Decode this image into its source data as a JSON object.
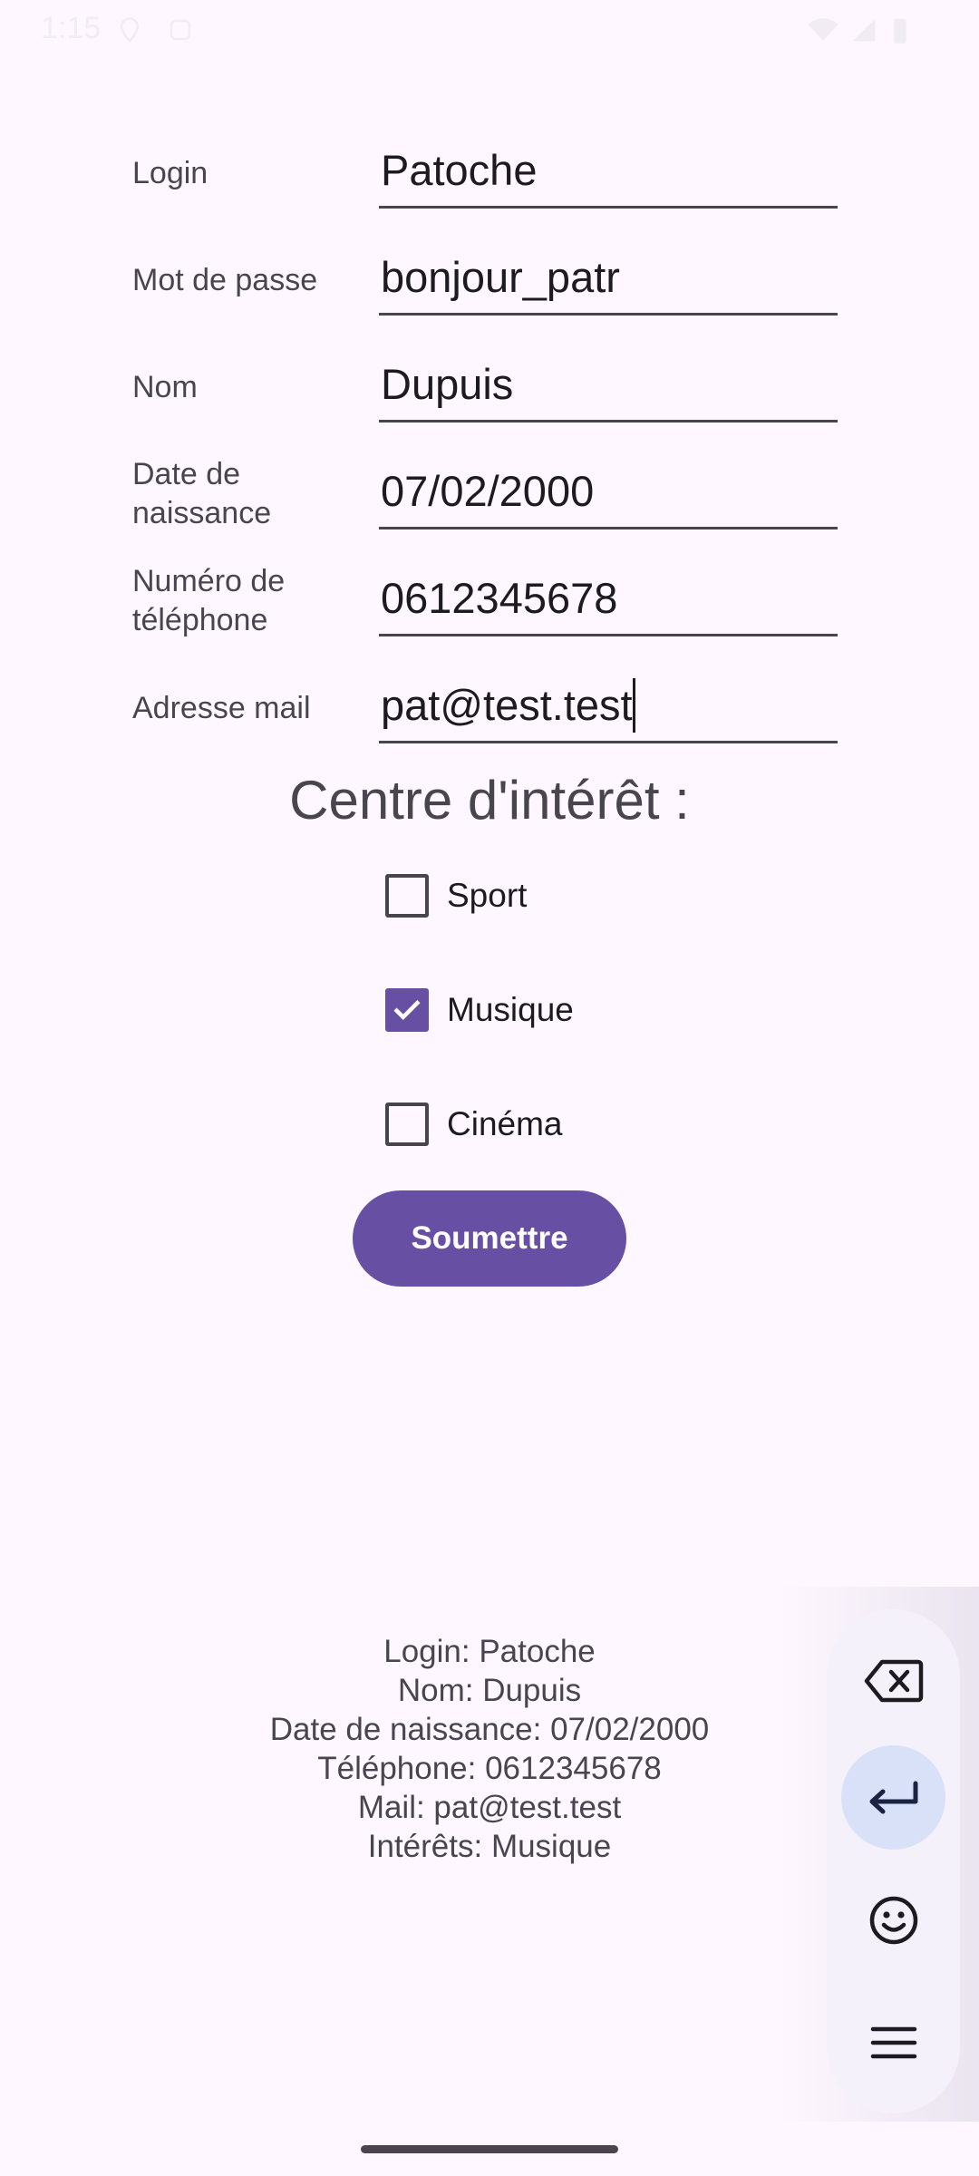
{
  "status_bar": {
    "time": "1:15"
  },
  "form": {
    "fields": [
      {
        "label": "Login",
        "value": "Patoche"
      },
      {
        "label": "Mot de passe",
        "value": "bonjour_patr"
      },
      {
        "label": "Nom",
        "value": "Dupuis"
      },
      {
        "label": "Date de\nnaissance",
        "value": "07/02/2000"
      },
      {
        "label": "Numéro de\ntéléphone",
        "value": "0612345678"
      },
      {
        "label": "Adresse mail",
        "value": "pat@test.test"
      }
    ],
    "interests_title": "Centre d'intérêt :",
    "checkboxes": [
      {
        "label": "Sport",
        "checked": false
      },
      {
        "label": "Musique",
        "checked": true
      },
      {
        "label": "Cinéma",
        "checked": false
      }
    ],
    "submit_label": "Soumettre"
  },
  "summary": {
    "lines": [
      "Login: Patoche",
      "Nom: Dupuis",
      "Date de naissance: 07/02/2000",
      "Téléphone: 0612345678",
      "Mail: pat@test.test",
      "Intérêts: Musique"
    ]
  },
  "keyboard_toolbar": {
    "icons": [
      "backspace-icon",
      "enter-icon",
      "emoji-icon",
      "menu-icon"
    ],
    "active": "enter-icon"
  },
  "colors": {
    "background": "#FEF7FF",
    "accent": "#6750A4",
    "label_text": "#49454F",
    "field_text": "#1D1B20",
    "toolbar_active": "#D8E1F8"
  }
}
